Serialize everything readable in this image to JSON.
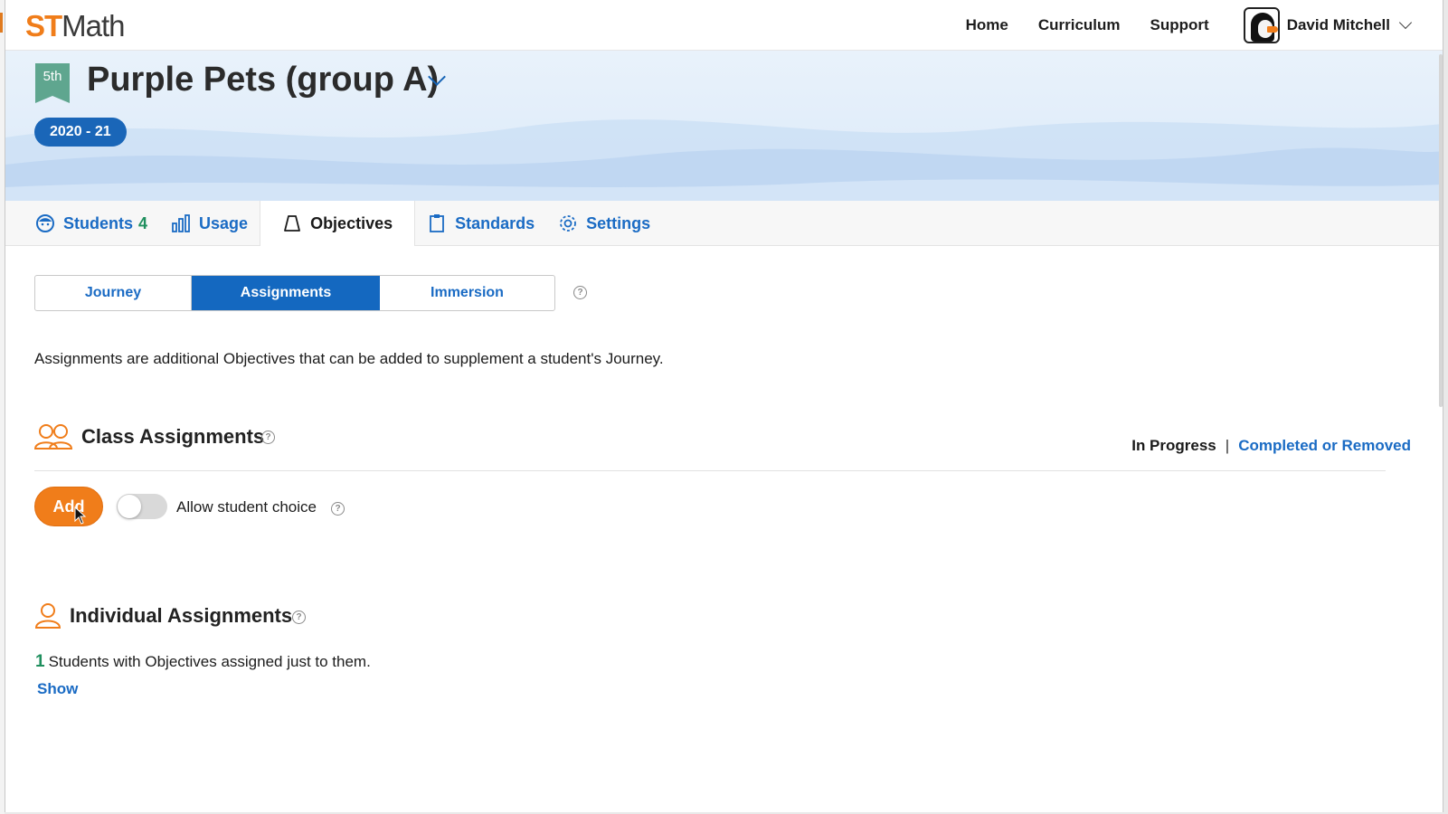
{
  "header": {
    "logo_st": "ST",
    "logo_math": "Math",
    "nav": [
      "Home",
      "Curriculum",
      "Support"
    ],
    "user_name": "David Mitchell"
  },
  "banner": {
    "grade": "5th",
    "class_name": "Purple Pets (group A)",
    "school_year": "2020 - 21"
  },
  "tabs": [
    {
      "label": "Students",
      "count": "4",
      "icon": "students-icon"
    },
    {
      "label": "Usage",
      "icon": "bar-chart-icon"
    },
    {
      "label": "Objectives",
      "icon": "bell-icon",
      "active": true
    },
    {
      "label": "Standards",
      "icon": "clipboard-icon"
    },
    {
      "label": "Settings",
      "icon": "gear-icon"
    }
  ],
  "segments": {
    "journey": "Journey",
    "assignments": "Assignments",
    "immersion": "Immersion",
    "selected": "Assignments"
  },
  "description": "Assignments are additional Objectives that can be added to supplement a student's Journey.",
  "class_assignments": {
    "title": "Class Assignments",
    "filter_in_progress": "In Progress",
    "filter_separator": "|",
    "filter_completed": "Completed or Removed",
    "add_label": "Add",
    "toggle_label": "Allow student choice",
    "toggle_on": false
  },
  "individual_assignments": {
    "title": "Individual Assignments",
    "count": "1",
    "count_text": "Students with Objectives assigned just to them.",
    "show_label": "Show"
  },
  "help_glyph": "?",
  "colors": {
    "orange": "#f07d1a",
    "blue": "#1468c0",
    "green": "#1f8f5e"
  }
}
